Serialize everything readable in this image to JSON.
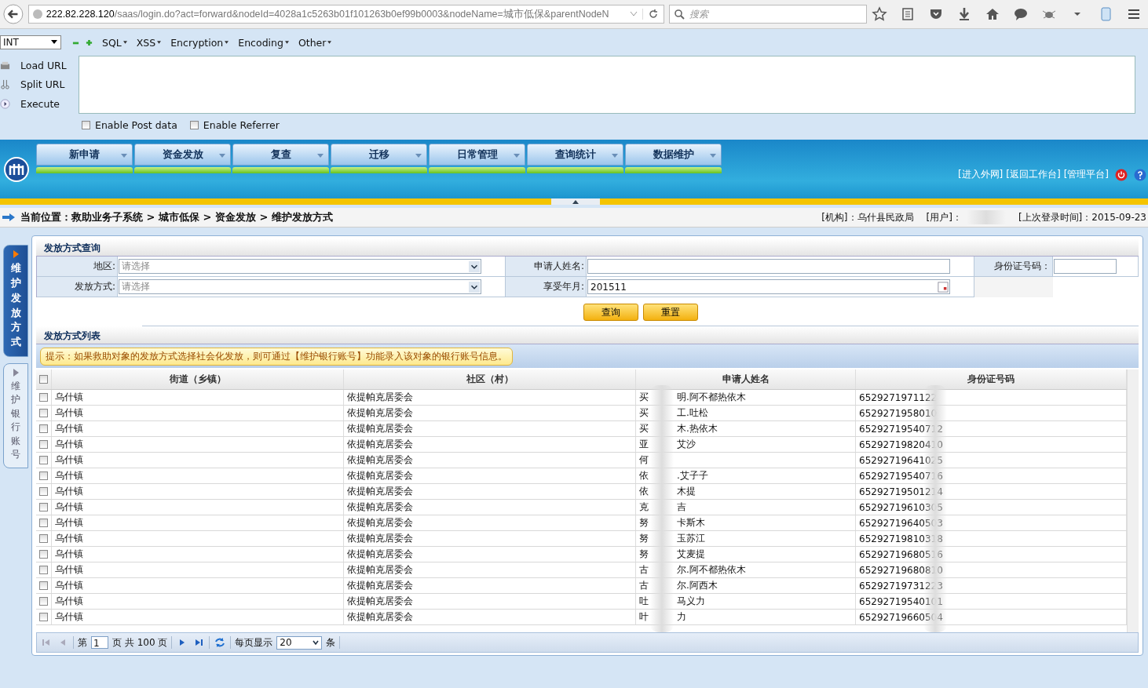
{
  "browser": {
    "url_host": "222.82.228.120",
    "url_path": "/saas/login.do?act=forward&nodeId=4028a1c5263b01f101263b0ef99b0003&nodeName=城市低保&parentNodeN",
    "search_placeholder": "搜索"
  },
  "hackbar": {
    "select_value": "INT",
    "menus": [
      "SQL",
      "XSS",
      "Encryption",
      "Encoding",
      "Other"
    ],
    "actions": [
      "Load URL",
      "Split URL",
      "Execute"
    ],
    "options": [
      {
        "label": "Enable Post data",
        "checked": false
      },
      {
        "label": "Enable Referrer",
        "checked": false
      }
    ]
  },
  "nav": {
    "tabs": [
      "新申请",
      "资金发放",
      "复查",
      "迁移",
      "日常管理",
      "查询统计",
      "数据维护"
    ],
    "links": [
      "[进入外网]",
      "[返回工作台]",
      "[管理平台]"
    ]
  },
  "breadcrumb": {
    "location": "当前位置：救助业务子系统 > 城市低保 > 资金发放 > 维护发放方式",
    "org": "[机构]：乌什县民政局",
    "user": "[用户]：",
    "last_login": "[上次登录时间]：2015-09-23"
  },
  "side_tabs": [
    {
      "label": "维护发放方式",
      "selected": true
    },
    {
      "label": "维护银行账号",
      "selected": false
    }
  ],
  "query": {
    "title": "发放方式查询",
    "fields": [
      {
        "label": "地区:",
        "kind": "select",
        "placeholder": "请选择"
      },
      {
        "label": "申请人姓名:",
        "kind": "text"
      },
      {
        "label": "身份证号码：",
        "kind": "text"
      },
      {
        "label": "发放方式:",
        "kind": "select",
        "placeholder": "请选择"
      },
      {
        "label": "享受年月:",
        "kind": "date",
        "value": "201511"
      }
    ],
    "buttons": [
      "查询",
      "重置"
    ]
  },
  "list": {
    "title": "发放方式列表",
    "hint": "提示：如果救助对象的发放方式选择社会化发放，则可通过【维护银行账号】功能录入该对象的银行账号信息。",
    "all_checked": false,
    "columns": [
      "街道（乡镇）",
      "社区（村）",
      "申请人姓名",
      "身份证号码"
    ],
    "rows": [
      {
        "street": "乌什镇",
        "community": "依提帕克居委会",
        "name_start": "买",
        "name_end": "明.阿不都热依木",
        "id": "6529271971122",
        "checked": false
      },
      {
        "street": "乌什镇",
        "community": "依提帕克居委会",
        "name_start": "买",
        "name_end": "工.吐松",
        "id": "6529271958010",
        "checked": false
      },
      {
        "street": "乌什镇",
        "community": "依提帕克居委会",
        "name_start": "买",
        "name_end": "木.热依木",
        "id": "65292719540712",
        "checked": false
      },
      {
        "street": "乌什镇",
        "community": "依提帕克居委会",
        "name_start": "亚",
        "name_end": "艾沙",
        "id": "65292719820410",
        "checked": false
      },
      {
        "street": "乌什镇",
        "community": "依提帕克居委会",
        "name_start": "何",
        "id": "65292719641025",
        "checked": false
      },
      {
        "street": "乌什镇",
        "community": "依提帕克居委会",
        "name_start": "依",
        "name_end": ".艾子子",
        "id": "65292719540716",
        "checked": false
      },
      {
        "street": "乌什镇",
        "community": "依提帕克居委会",
        "name_start": "依",
        "name_end": "木提",
        "id": "65292719501214",
        "checked": false
      },
      {
        "street": "乌什镇",
        "community": "依提帕克居委会",
        "name_start": "克",
        "name_end": "吉",
        "id": "65292719610305",
        "checked": false
      },
      {
        "street": "乌什镇",
        "community": "依提帕克居委会",
        "name_start": "努",
        "name_end": "卡斯木",
        "id": "65292719640503",
        "checked": false
      },
      {
        "street": "乌什镇",
        "community": "依提帕克居委会",
        "name_start": "努",
        "name_end": "玉苏江",
        "id": "65292719810318",
        "checked": false
      },
      {
        "street": "乌什镇",
        "community": "依提帕克居委会",
        "name_start": "努",
        "name_end": "艾麦提",
        "id": "65292719680516",
        "checked": false
      },
      {
        "street": "乌什镇",
        "community": "依提帕克居委会",
        "name_start": "古",
        "name_end": "尔.阿不都热依木",
        "id": "65292719680810",
        "checked": false
      },
      {
        "street": "乌什镇",
        "community": "依提帕克居委会",
        "name_start": "古",
        "name_end": "尔.阿西木",
        "id": "65292719731223",
        "checked": false
      },
      {
        "street": "乌什镇",
        "community": "依提帕克居委会",
        "name_start": "吐",
        "name_end": "马义力",
        "id": "65292719540101",
        "checked": false
      },
      {
        "street": "乌什镇",
        "community": "依提帕克居委会",
        "name_start": "叶",
        "name_end": "力",
        "id": "65292719660504",
        "checked": false
      }
    ],
    "pager": {
      "page_label": "第",
      "page": "1",
      "total": "页 共 100 页",
      "per_page_label": "每页显示",
      "per_page": "20",
      "unit": "条"
    }
  }
}
